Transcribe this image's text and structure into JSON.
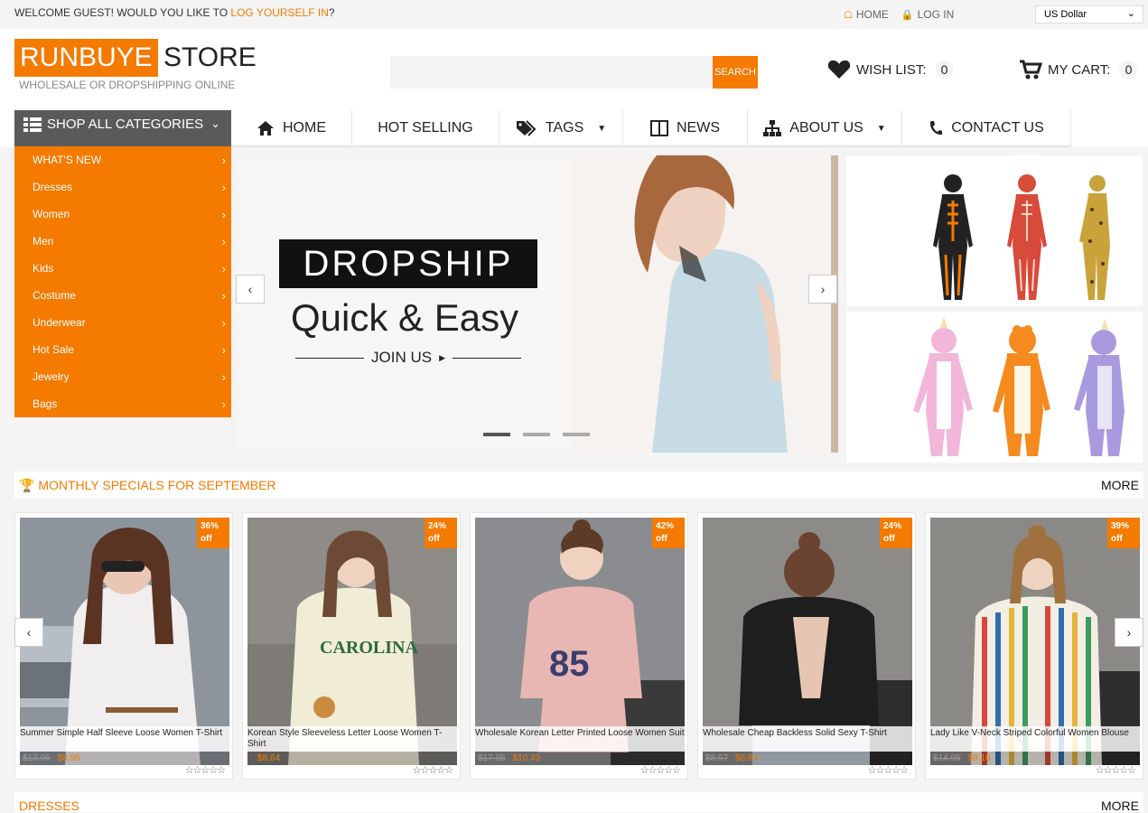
{
  "topbar": {
    "welcome_prefix": "WELCOME GUEST! WOULD YOU LIKE TO ",
    "login_link": "LOG YOURSELF IN",
    "welcome_suffix": "?",
    "home_link": "HOME",
    "login_top": "LOG IN",
    "currency": "US Dollar"
  },
  "header": {
    "logo_main": "RUNBUYE",
    "logo_suffix": "STORE",
    "tagline": "WHOLESALE OR DROPSHIPPING ONLINE",
    "search_placeholder": "",
    "search_button": "SEARCH",
    "wishlist_label": "WISH LIST:",
    "wishlist_count": "0",
    "cart_label": "MY CART:",
    "cart_count": "0"
  },
  "nav": {
    "categories_button": "SHOP ALL CATEGORIES",
    "items": [
      "HOME",
      "HOT SELLING",
      "TAGS",
      "NEWS",
      "ABOUT US",
      "CONTACT US"
    ]
  },
  "sidebar": {
    "items": [
      "WHAT'S NEW",
      "Dresses",
      "Women",
      "Men",
      "Kids",
      "Costume",
      "Underwear",
      "Hot Sale",
      "Jewelry",
      "Bags"
    ]
  },
  "banner": {
    "headline": "DROPSHIP",
    "subline": "Quick & Easy",
    "cta": "JOIN US"
  },
  "monthly": {
    "title": "MONTHLY SPECIALS FOR SEPTEMBER",
    "more": "MORE",
    "products": [
      {
        "name": "Summer Simple Half Sleeve Loose Women T-Shirt",
        "badge_pct": "36%",
        "badge_off": "off",
        "old_price": "$13.95",
        "new_price": "$8.95"
      },
      {
        "name": "Korean Style Sleeveless Letter Loose Women T-Shirt",
        "badge_pct": "24%",
        "badge_off": "off",
        "old_price": "",
        "new_price": "$8.64"
      },
      {
        "name": "Wholesale Korean Letter Printed Loose Women Suit",
        "badge_pct": "42%",
        "badge_off": "off",
        "old_price": "$17.95",
        "new_price": "$10.43"
      },
      {
        "name": "Wholesale Cheap Backless Solid Sexy T-Shirt",
        "badge_pct": "24%",
        "badge_off": "off",
        "old_price": "$8.97",
        "new_price": "$6.84"
      },
      {
        "name": "Lady Like V-Neck Striped Colorful Women Blouse",
        "badge_pct": "39%",
        "badge_off": "off",
        "old_price": "$14.95",
        "new_price": "$9.16"
      }
    ],
    "stars": "☆☆☆☆☆"
  },
  "dresses": {
    "title": "DRESSES",
    "more": "MORE"
  },
  "colors": {
    "accent": "#f47a00",
    "dark_nav": "#5a5a5a"
  }
}
